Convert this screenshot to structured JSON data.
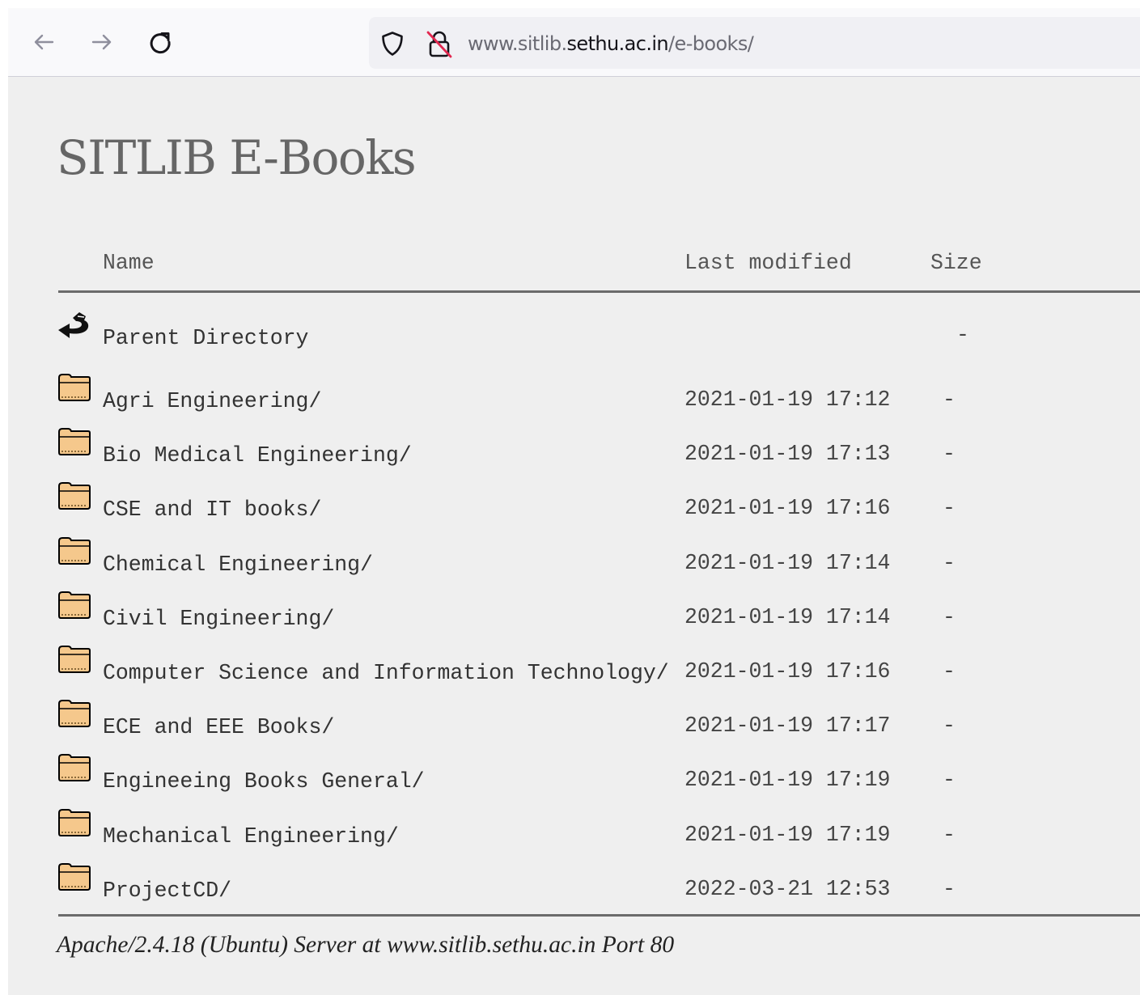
{
  "browser": {
    "url_prefix": "www.sitlib.",
    "url_domain": "sethu.ac.in",
    "url_path": "/e-books/"
  },
  "page": {
    "title": "SITLIB E-Books"
  },
  "table": {
    "headers": {
      "name": "Name",
      "last_modified": "Last modified",
      "size": "Size"
    },
    "parent": {
      "name": "Parent Directory",
      "size": "-"
    },
    "rows": [
      {
        "name": "Agri Engineering/",
        "modified": "2021-01-19 17:12",
        "size": "-"
      },
      {
        "name": "Bio Medical Engineering/",
        "modified": "2021-01-19 17:13",
        "size": "-"
      },
      {
        "name": "CSE and IT books/",
        "modified": "2021-01-19 17:16",
        "size": "-"
      },
      {
        "name": "Chemical Engineering/",
        "modified": "2021-01-19 17:14",
        "size": "-"
      },
      {
        "name": "Civil Engineering/",
        "modified": "2021-01-19 17:14",
        "size": "-"
      },
      {
        "name": "Computer Science and Information Technology/",
        "modified": "2021-01-19 17:16",
        "size": "-"
      },
      {
        "name": "ECE and EEE Books/",
        "modified": "2021-01-19 17:17",
        "size": "-"
      },
      {
        "name": "Engineeing Books General/",
        "modified": "2021-01-19 17:19",
        "size": "-"
      },
      {
        "name": "Mechanical Engineering/",
        "modified": "2021-01-19 17:19",
        "size": "-"
      },
      {
        "name": "ProjectCD/",
        "modified": "2022-03-21 12:53",
        "size": "-"
      }
    ]
  },
  "footer": {
    "text": "Apache/2.4.18 (Ubuntu) Server at www.sitlib.sethu.ac.in Port 80"
  },
  "icons": {
    "back": "arrow-left-icon",
    "forward": "arrow-right-icon",
    "reload": "reload-icon",
    "tracking": "shield-icon",
    "connection": "insecure-lock-icon",
    "parent": "back-arrow-icon",
    "folder": "folder-icon"
  },
  "colors": {
    "page_background": "#efefef",
    "toolbar_background": "#f9f9fb",
    "urlbar_background": "#f0f0f4",
    "title": "#666666",
    "folder_fill": "#f5c88c",
    "insecure_slash": "#e22850"
  }
}
